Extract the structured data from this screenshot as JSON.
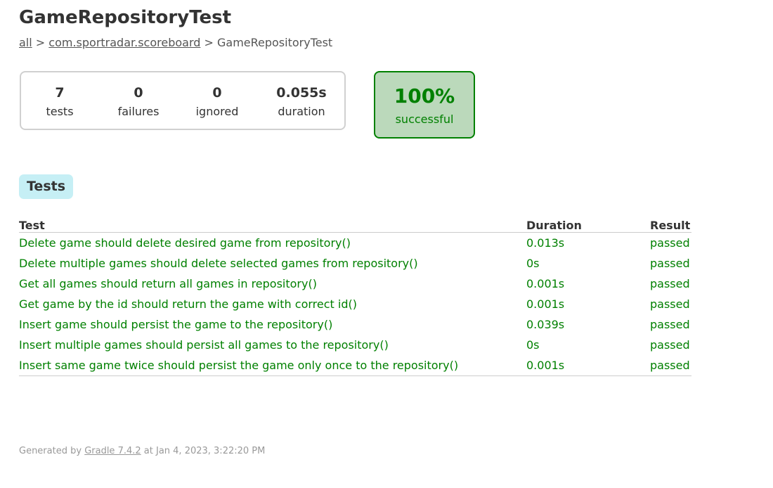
{
  "page": {
    "title": "GameRepositoryTest"
  },
  "breadcrumbs": {
    "root_link": "all",
    "sep1": " > ",
    "package_link": "com.sportradar.scoreboard",
    "sep2": " > ",
    "current": "GameRepositoryTest"
  },
  "summary": {
    "tests": {
      "value": "7",
      "label": "tests"
    },
    "failures": {
      "value": "0",
      "label": "failures"
    },
    "ignored": {
      "value": "0",
      "label": "ignored"
    },
    "duration": {
      "value": "0.055s",
      "label": "duration"
    },
    "success_rate": {
      "value": "100%",
      "label": "successful"
    }
  },
  "tabs": {
    "tests_label": "Tests"
  },
  "table": {
    "headers": {
      "test": "Test",
      "duration": "Duration",
      "result": "Result"
    },
    "rows": [
      {
        "test": "Delete game should delete desired game from repository()",
        "duration": "0.013s",
        "result": "passed"
      },
      {
        "test": "Delete multiple games should delete selected games from repository()",
        "duration": "0s",
        "result": "passed"
      },
      {
        "test": "Get all games should return all games in repository()",
        "duration": "0.001s",
        "result": "passed"
      },
      {
        "test": "Get game by the id should return the game with correct id()",
        "duration": "0.001s",
        "result": "passed"
      },
      {
        "test": "Insert game should persist the game to the repository()",
        "duration": "0.039s",
        "result": "passed"
      },
      {
        "test": "Insert multiple games should persist all games to the repository()",
        "duration": "0s",
        "result": "passed"
      },
      {
        "test": "Insert same game twice should persist the game only once to the repository()",
        "duration": "0.001s",
        "result": "passed"
      }
    ]
  },
  "footer": {
    "prefix": "Generated by ",
    "link": "Gradle 7.4.2",
    "suffix": " at Jan 4, 2023, 3:22:20 PM"
  },
  "colors": {
    "success": "#008000",
    "success_bg": "#bbd9bb",
    "tab_bg": "#c6eff5"
  }
}
